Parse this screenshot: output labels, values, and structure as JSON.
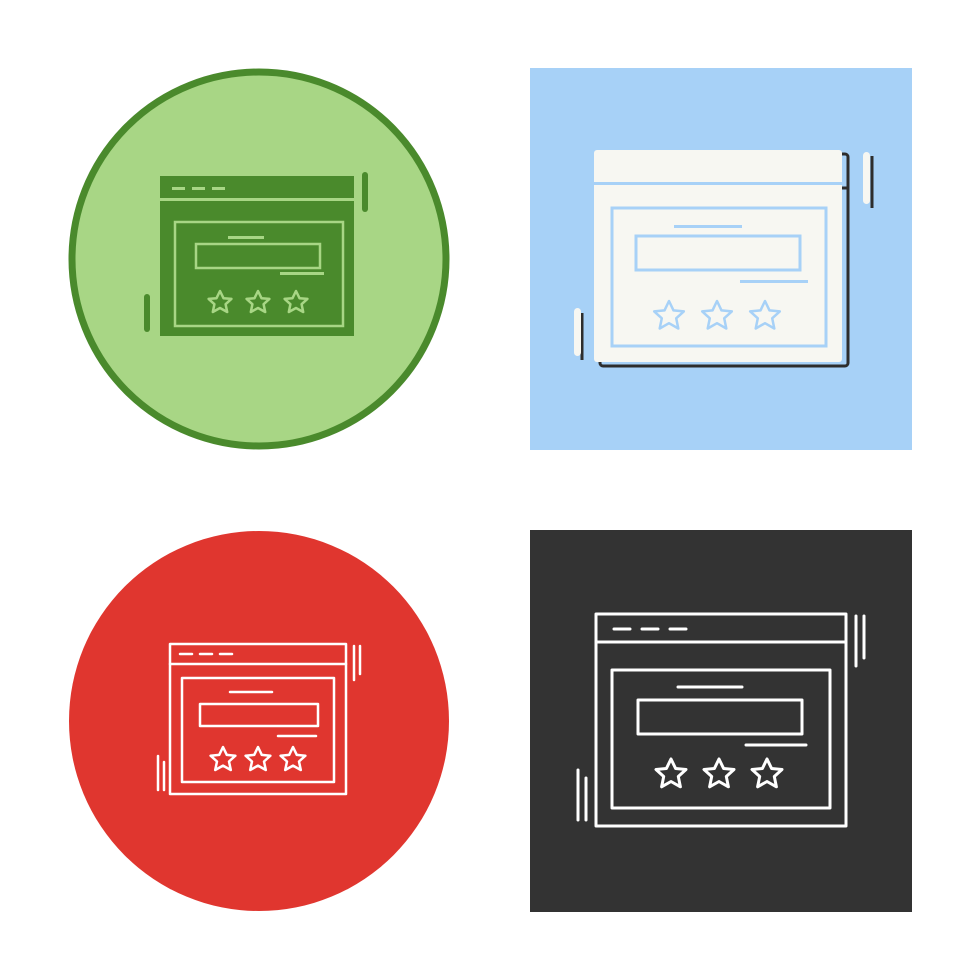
{
  "icon_semantic": "website-rating-icon",
  "variants": [
    {
      "style": "glyph-filled",
      "background_shape": "circle",
      "background": "#a8d685",
      "border": "#4a8a2c",
      "primary": "#4a8a2c",
      "secondary": "#a8d685"
    },
    {
      "style": "flat-shadow",
      "background_shape": "square",
      "background": "#a7d1f7",
      "primary": "#f7f7f2",
      "outline": "#2d2d2d"
    },
    {
      "style": "outline",
      "background_shape": "circle",
      "background": "#e0362f",
      "primary": "#ffffff"
    },
    {
      "style": "outline",
      "background_shape": "square",
      "background": "#333333",
      "primary": "#ffffff"
    }
  ],
  "stars_per_icon": 3
}
